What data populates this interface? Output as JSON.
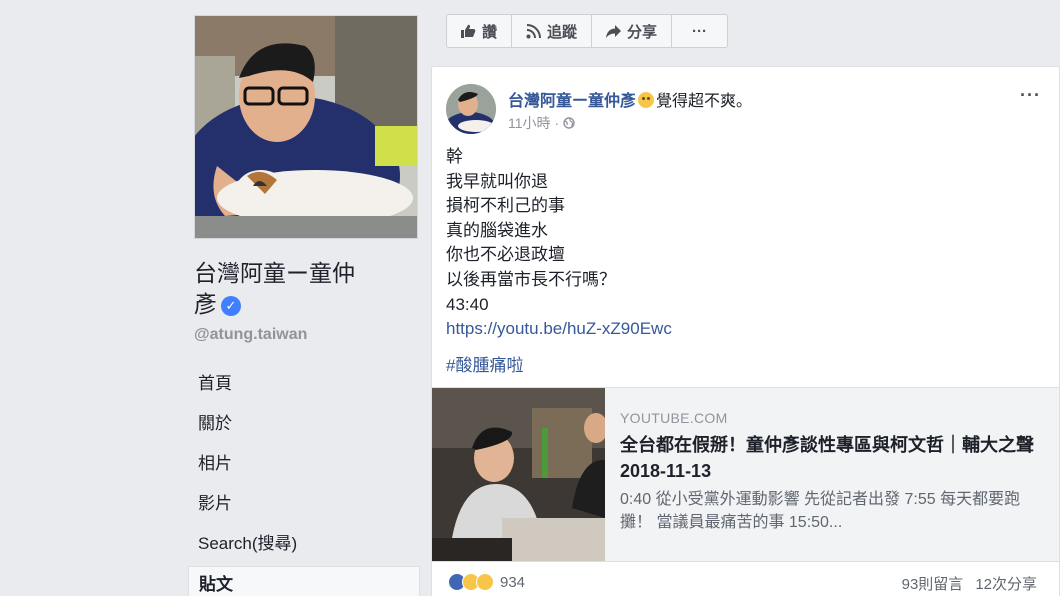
{
  "page": {
    "name_line1": "台灣阿童ー童仲",
    "name_line2": "彥",
    "handle": "@atung.taiwan"
  },
  "nav": {
    "items": [
      "首頁",
      "關於",
      "相片",
      "影片",
      "Search(搜尋)",
      "貼文"
    ]
  },
  "action_bar": {
    "like": "讚",
    "follow": "追蹤",
    "share": "分享",
    "more": "···"
  },
  "post": {
    "author": "台灣阿童ー童仲彥",
    "feeling": "覺得超不爽。",
    "time": "11小時",
    "more": "···",
    "body_lines": [
      "幹",
      "我早就叫你退",
      "損柯不利己的事",
      "真的腦袋進水",
      "你也不必退政壇",
      "以後再當市長不行嗎？",
      "43:40"
    ],
    "link": "https://youtu.be/huZ-xZ90Ewc",
    "hashtag": "#酸腫痛啦"
  },
  "preview": {
    "source": "YOUTUBE.COM",
    "title": "全台都在假掰！童仲彥談性專區與柯文哲｜輔大之聲2018-11-13",
    "description": "0:40 從小受黨外運動影響 先從記者出發 7:55 每天都要跑攤！ 當議員最痛苦的事 15:50..."
  },
  "stats": {
    "reactions": "934",
    "comments": "93則留言",
    "shares": "12次分享"
  },
  "colors": {
    "link": "#365899",
    "verified": "#4080ff",
    "background": "#e9ebee"
  }
}
